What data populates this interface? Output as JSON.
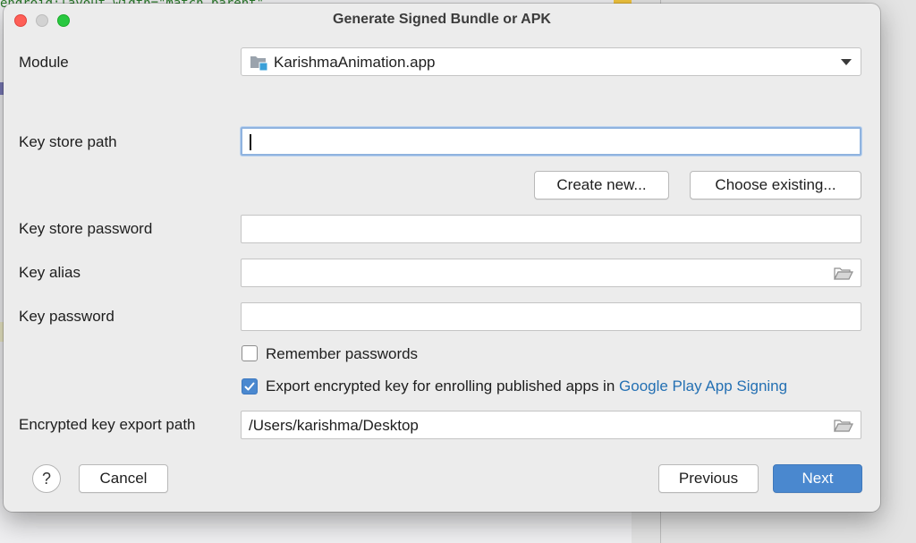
{
  "background": {
    "code_text": "endroid:layout_width=\"match_parent\""
  },
  "dialog": {
    "title": "Generate Signed Bundle or APK"
  },
  "module": {
    "label": "Module",
    "value": "KarishmaAnimation.app"
  },
  "key_store_path": {
    "label": "Key store path",
    "value": ""
  },
  "buttons": {
    "create_new": "Create new...",
    "choose_existing": "Choose existing...",
    "cancel": "Cancel",
    "previous": "Previous",
    "next": "Next",
    "help": "?"
  },
  "key_store_password": {
    "label": "Key store password",
    "value": ""
  },
  "key_alias": {
    "label": "Key alias",
    "value": ""
  },
  "key_password": {
    "label": "Key password",
    "value": ""
  },
  "remember_passwords": {
    "label": "Remember passwords",
    "checked": false
  },
  "export_encrypted": {
    "label": "Export encrypted key for enrolling published apps in ",
    "link": "Google Play App Signing",
    "checked": true
  },
  "encrypted_key_export_path": {
    "label": "Encrypted key export path",
    "value": "/Users/karishma/Desktop"
  },
  "icons": {
    "module": "module-folder-icon",
    "browse": "folder-icon",
    "dropdown": "chevron-down-icon",
    "checkmark": "checkmark-icon"
  },
  "colors": {
    "primary_button": "#4a88cf",
    "link": "#2470b3",
    "focus_ring": "#8fb3df",
    "close": "#fe5f57",
    "maximize": "#28c840"
  }
}
